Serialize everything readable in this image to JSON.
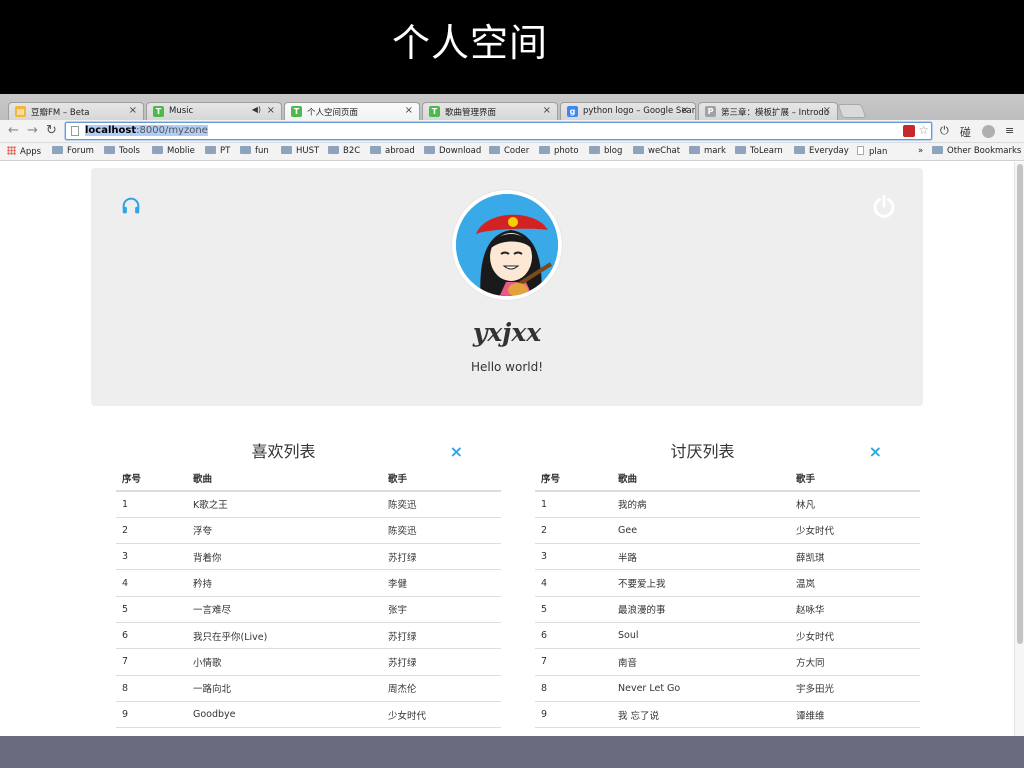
{
  "slide": {
    "title": "个人空间"
  },
  "tabs": [
    {
      "label": "豆瓣FM – Beta",
      "favicon_color": "#f2b63b",
      "active": false
    },
    {
      "label": "Music",
      "favicon_color": "#4db84c",
      "active": false
    },
    {
      "label": "个人空间页面",
      "favicon_color": "#4db84c",
      "active": true
    },
    {
      "label": "歌曲管理界面",
      "favicon_color": "#4db84c",
      "active": false
    },
    {
      "label": "python logo – Google Sear",
      "favicon_color": "#4285f4",
      "active": false
    },
    {
      "label": "第三章：模板扩展 – Introdu",
      "favicon_color": "#9fa3a8",
      "active": false
    }
  ],
  "favicon_glyphs": {
    "douban": "▤",
    "g": "g",
    "p": "P",
    "site": "T"
  },
  "address_bar": {
    "host": "localhost",
    "rest": ":8000/myzone"
  },
  "toolbar_icons": [
    "back-icon",
    "forward-icon",
    "reload-icon",
    "star-icon",
    "power-icon",
    "extension-icon",
    "menu-icon"
  ],
  "toolbar_ext_text": "碰",
  "bookmarks": [
    {
      "label": "Apps",
      "kind": "apps"
    },
    {
      "label": "Forum",
      "kind": "folder"
    },
    {
      "label": "Tools",
      "kind": "folder"
    },
    {
      "label": "Moblie",
      "kind": "folder"
    },
    {
      "label": "PT",
      "kind": "folder"
    },
    {
      "label": "fun",
      "kind": "folder"
    },
    {
      "label": "HUST",
      "kind": "folder"
    },
    {
      "label": "B2C",
      "kind": "folder"
    },
    {
      "label": "abroad",
      "kind": "folder"
    },
    {
      "label": "Download",
      "kind": "folder"
    },
    {
      "label": "Coder",
      "kind": "folder"
    },
    {
      "label": "photo",
      "kind": "folder"
    },
    {
      "label": "blog",
      "kind": "folder"
    },
    {
      "label": "weChat",
      "kind": "folder"
    },
    {
      "label": "mark",
      "kind": "folder"
    },
    {
      "label": "ToLearn",
      "kind": "folder"
    },
    {
      "label": "Everyday",
      "kind": "folder"
    },
    {
      "label": "plan",
      "kind": "doc"
    }
  ],
  "bookmarks_overflow": "»",
  "other_bookmarks": "Other Bookmarks",
  "profile": {
    "username": "yxjxx",
    "tagline": "Hello world!"
  },
  "liked": {
    "title": "喜欢列表",
    "clear": "×",
    "headers": [
      "序号",
      "歌曲",
      "歌手"
    ],
    "rows": [
      [
        "1",
        "K歌之王",
        "陈奕迅"
      ],
      [
        "2",
        "浮夸",
        "陈奕迅"
      ],
      [
        "3",
        "背着你",
        "苏打绿"
      ],
      [
        "4",
        "矜持",
        "李健"
      ],
      [
        "5",
        "一言难尽",
        "张宇"
      ],
      [
        "6",
        "我只在乎你(Live)",
        "苏打绿"
      ],
      [
        "7",
        "小情歌",
        "苏打绿"
      ],
      [
        "8",
        "一路向北",
        "周杰伦"
      ],
      [
        "9",
        "Goodbye",
        "少女时代"
      ]
    ]
  },
  "disliked": {
    "title": "讨厌列表",
    "clear": "×",
    "headers": [
      "序号",
      "歌曲",
      "歌手"
    ],
    "rows": [
      [
        "1",
        "我的病",
        "林凡"
      ],
      [
        "2",
        "Gee",
        "少女时代"
      ],
      [
        "3",
        "半路",
        "薛凯琪"
      ],
      [
        "4",
        "不要爱上我",
        "温岚"
      ],
      [
        "5",
        "最浪漫的事",
        "赵咏华"
      ],
      [
        "6",
        "Soul",
        "少女时代"
      ],
      [
        "7",
        "南音",
        "方大同"
      ],
      [
        "8",
        "Never Let Go",
        "宇多田光"
      ],
      [
        "9",
        "我 忘了说",
        "谭维维"
      ]
    ]
  },
  "colors": {
    "accent": "#2fa4e7",
    "jumbotron_bg": "#eeeeee",
    "desktop": "#6b6b80"
  }
}
